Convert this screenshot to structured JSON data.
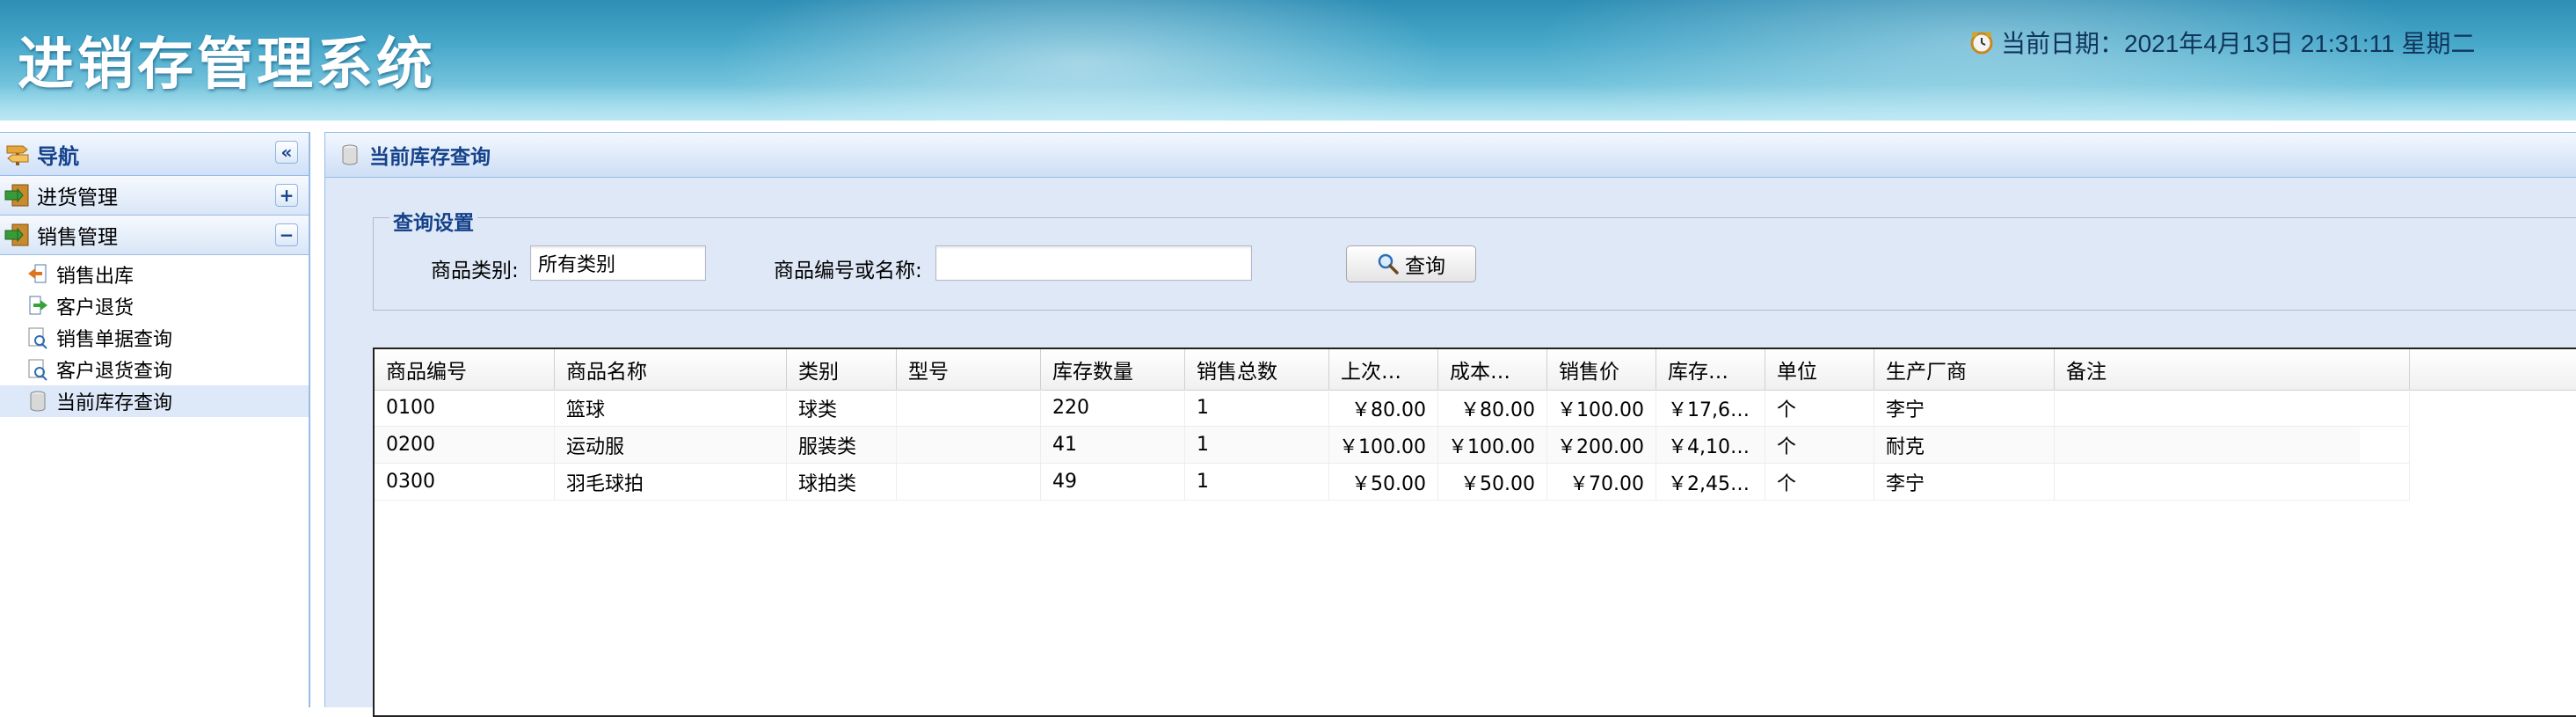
{
  "app": {
    "title": "进销存管理系统",
    "date_text": "当前日期：2021年4月13日 21:31:11 星期二"
  },
  "nav": {
    "title": "导航",
    "groups": [
      {
        "label": "进货管理",
        "toggle": "+"
      },
      {
        "label": "销售管理",
        "toggle": "−"
      }
    ],
    "items": [
      {
        "label": "销售出库",
        "icon": "arrow-left-icon"
      },
      {
        "label": "客户退货",
        "icon": "arrow-right-icon"
      },
      {
        "label": "销售单据查询",
        "icon": "document-search-icon"
      },
      {
        "label": "客户退货查询",
        "icon": "document-search-icon"
      },
      {
        "label": "当前库存查询",
        "icon": "database-icon",
        "selected": true
      }
    ],
    "collapse_glyph": "«"
  },
  "main": {
    "title": "当前库存查询",
    "query": {
      "legend": "查询设置",
      "category_label": "商品类别:",
      "category_value": "所有类别",
      "keyword_label": "商品编号或名称:",
      "keyword_value": "",
      "button_label": "查询"
    },
    "grid": {
      "columns": [
        "商品编号",
        "商品名称",
        "类别",
        "型号",
        "库存数量",
        "销售总数",
        "上次…",
        "成本…",
        "销售价",
        "库存…",
        "单位",
        "生产厂商",
        "备注"
      ],
      "rows": [
        [
          "0100",
          "篮球",
          "球类",
          "",
          "220",
          "1",
          "￥80.00",
          "￥80.00",
          "￥100.00",
          "￥17,6…",
          "个",
          "李宁",
          ""
        ],
        [
          "0200",
          "运动服",
          "服装类",
          "",
          "41",
          "1",
          "￥100.00",
          "￥100.00",
          "￥200.00",
          "￥4,10…",
          "个",
          "耐克",
          ""
        ],
        [
          "0300",
          "羽毛球拍",
          "球拍类",
          "",
          "49",
          "1",
          "￥50.00",
          "￥50.00",
          "￥70.00",
          "￥2,45…",
          "个",
          "李宁",
          ""
        ]
      ]
    }
  },
  "colors": {
    "header_blue": "#46a7c9",
    "panel_title": "#15428b",
    "panel_bg": "#dfe8f6",
    "selected_row": "#dde8f8"
  }
}
